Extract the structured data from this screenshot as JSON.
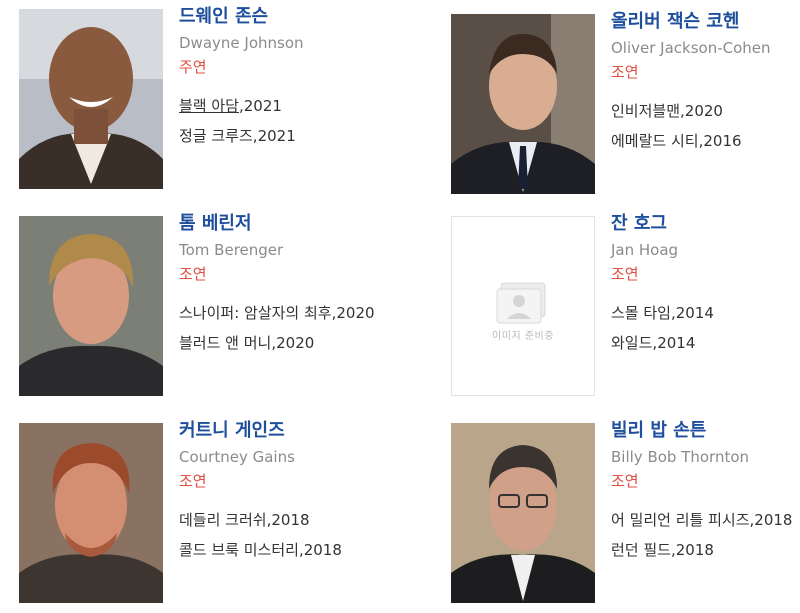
{
  "cast": [
    {
      "name_ko": "드웨인 존슨",
      "name_en": "Dwayne Johnson",
      "role": "주연",
      "works": [
        {
          "title": "블랙 아담",
          "year": "2021"
        },
        {
          "title": "정글 크루즈",
          "year": "2021"
        }
      ]
    },
    {
      "name_ko": "올리버 잭슨 코헨",
      "name_en": "Oliver Jackson-Cohen",
      "role": "조연",
      "works": [
        {
          "title": "인비저블맨",
          "year": "2020"
        },
        {
          "title": "에메랄드 시티",
          "year": "2016"
        }
      ]
    },
    {
      "name_ko": "톰 베린저",
      "name_en": "Tom Berenger",
      "role": "조연",
      "works": [
        {
          "title": "스나이퍼: 암살자의 최후",
          "year": "2020"
        },
        {
          "title": "블러드 앤 머니",
          "year": "2020"
        }
      ]
    },
    {
      "name_ko": "잔 호그",
      "name_en": "Jan Hoag",
      "role": "조연",
      "placeholder_text": "이미지 준비중",
      "works": [
        {
          "title": "스몰 타임",
          "year": "2014"
        },
        {
          "title": "와일드",
          "year": "2014"
        }
      ]
    },
    {
      "name_ko": "커트니 게인즈",
      "name_en": "Courtney Gains",
      "role": "조연",
      "works": [
        {
          "title": "데들리 크러쉬",
          "year": "2018"
        },
        {
          "title": "콜드 브룩 미스터리",
          "year": "2018"
        }
      ]
    },
    {
      "name_ko": "빌리 밥 손튼",
      "name_en": "Billy Bob Thornton",
      "role": "조연",
      "works": [
        {
          "title": "어 밀리언 리틀 피시즈",
          "year": "2018"
        },
        {
          "title": "런던 필드",
          "year": "2018"
        }
      ]
    }
  ],
  "colors": {
    "name": "#1e4f9c",
    "role": "#e04f3f",
    "english_name": "#8b8b8b",
    "work_text": "#333333"
  }
}
